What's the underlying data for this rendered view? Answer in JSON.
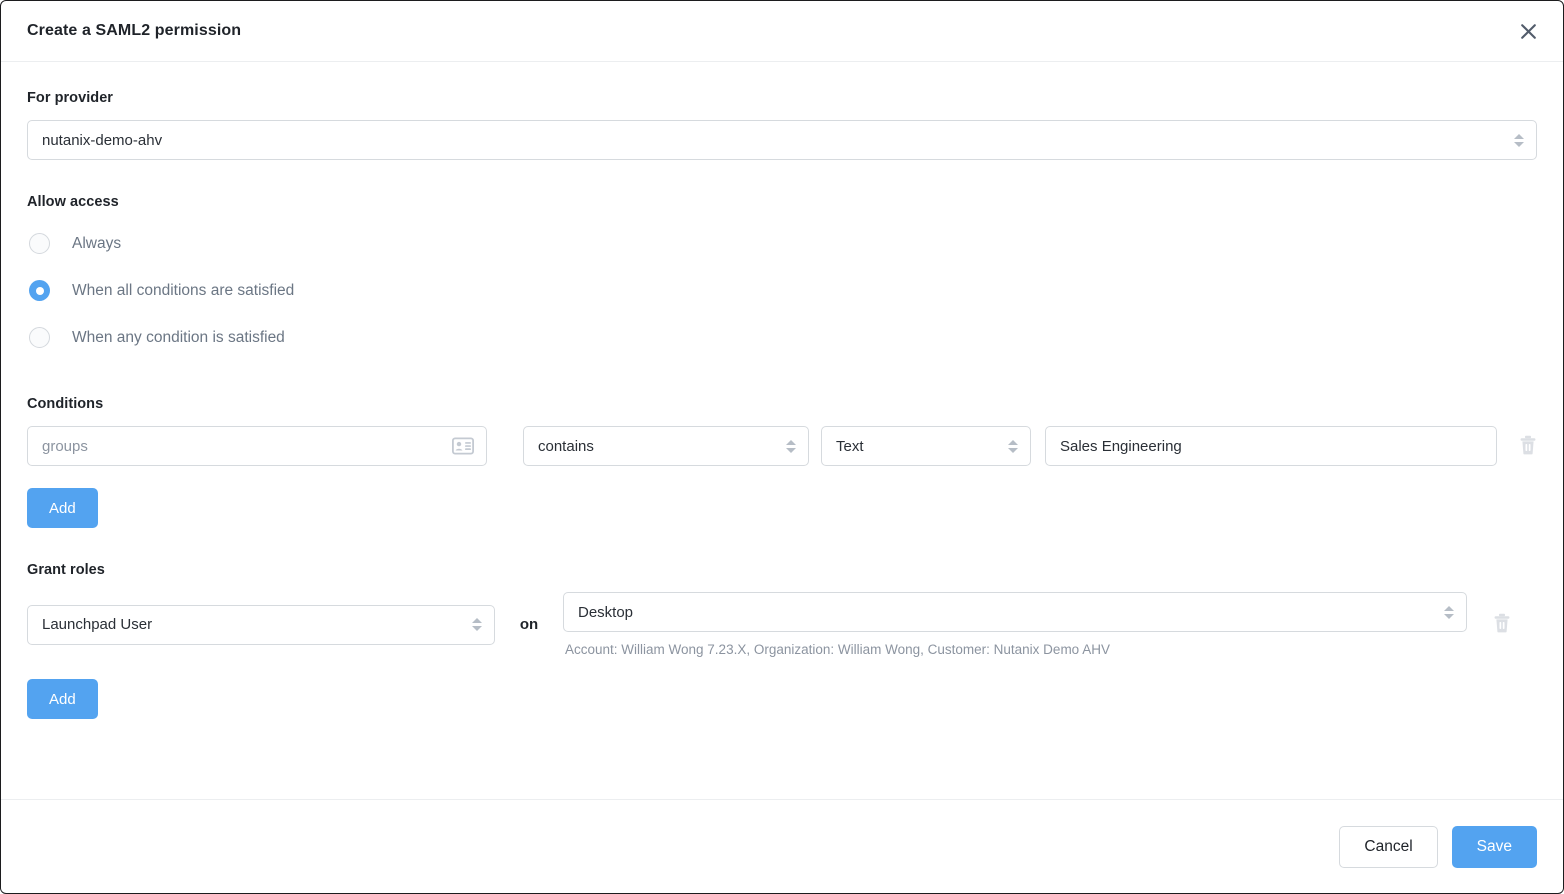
{
  "header": {
    "title": "Create a SAML2 permission",
    "close_icon": "close-icon"
  },
  "provider": {
    "label": "For provider",
    "value": "nutanix-demo-ahv"
  },
  "allow_access": {
    "label": "Allow access",
    "options": [
      {
        "label": "Always",
        "selected": false
      },
      {
        "label": "When all conditions are satisfied",
        "selected": true
      },
      {
        "label": "When any condition is satisfied",
        "selected": false
      }
    ]
  },
  "conditions": {
    "label": "Conditions",
    "rows": [
      {
        "attribute": "groups",
        "attribute_is_placeholder": true,
        "attribute_icon": "contact-card-icon",
        "operator": "contains",
        "value_type": "Text",
        "value": "Sales Engineering",
        "delete_icon": "trash-icon"
      }
    ],
    "add_label": "Add"
  },
  "grant_roles": {
    "label": "Grant roles",
    "conjunction": "on",
    "rows": [
      {
        "role": "Launchpad User",
        "target": "Desktop",
        "note": "Account: William Wong 7.23.X, Organization: William Wong, Customer: Nutanix Demo AHV",
        "delete_icon": "trash-icon"
      }
    ],
    "add_label": "Add"
  },
  "footer": {
    "cancel_label": "Cancel",
    "save_label": "Save"
  },
  "colors": {
    "accent": "#53a3f0",
    "border": "#d6dade",
    "muted_text": "#8c94a0",
    "label_text": "#1f2329",
    "radio_text": "#6b7684"
  }
}
